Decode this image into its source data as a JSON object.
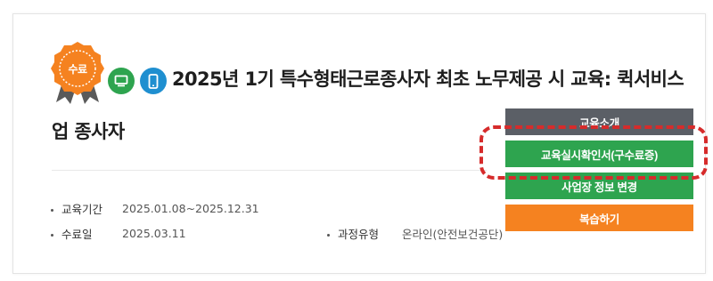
{
  "course": {
    "completion_badge": "수료",
    "title_line1": "2025년 1기 특수형태근로종사자 최초 노무제공 시 교육: 퀵서비스",
    "title_line2": "업 종사자",
    "icons": [
      "pc-icon",
      "mobile-icon"
    ]
  },
  "info": {
    "period_label": "교육기간",
    "period_value": "2025.01.08~2025.12.31",
    "completion_label": "수료일",
    "completion_value": "2025.03.11",
    "type_label": "과정유형",
    "type_value": "온라인(안전보건공단)"
  },
  "actions": {
    "intro_label": "교육소개",
    "cert_label": "교육실시확인서(구수료증)",
    "change_label": "사업장 정보 변경",
    "review_label": "복습하기"
  },
  "colors": {
    "green": "#2ea44f",
    "blue": "#1f8fd0",
    "orange": "#f58220",
    "gray": "#5b5f66",
    "highlight_red": "#d62b2b"
  }
}
